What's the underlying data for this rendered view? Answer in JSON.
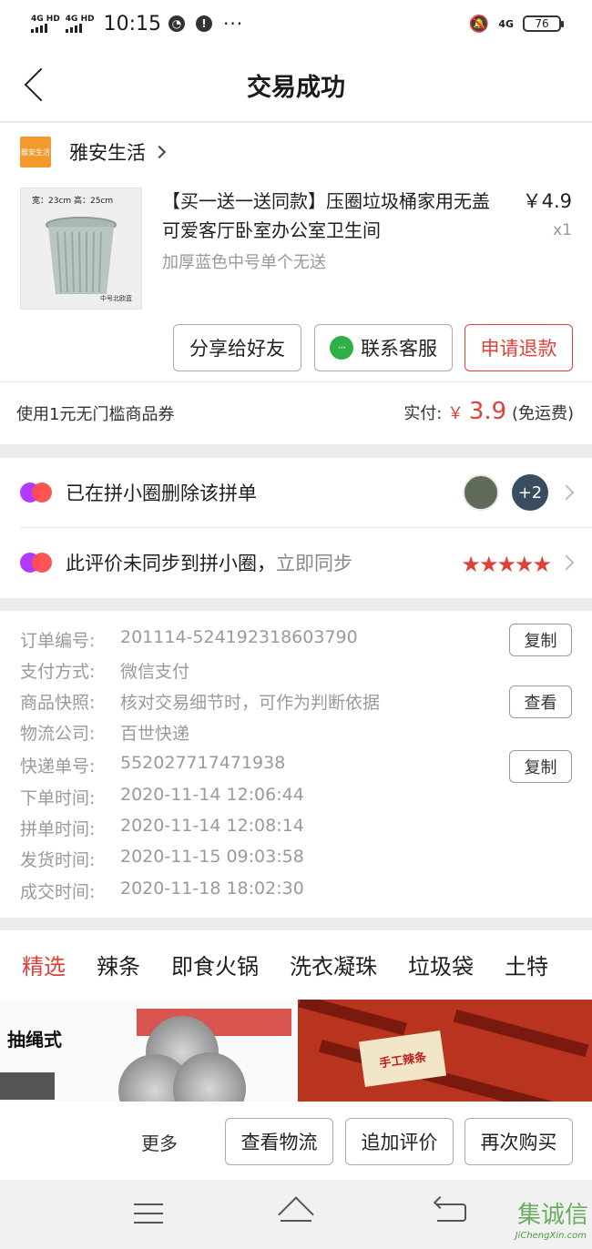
{
  "status_bar": {
    "network_1": "4G HD",
    "network_2": "4G HD",
    "time": "10:15",
    "network_right": "4G",
    "battery": "76"
  },
  "nav": {
    "title": "交易成功"
  },
  "store": {
    "name": "雅安生活",
    "logo_text": "雅安生活"
  },
  "product": {
    "image_dims": "宽：23cm  高：25cm",
    "image_caption": "中号北欧蓝",
    "title": "【买一送一送同款】压圈垃圾桶家用无盖可爱客厅卧室办公室卫生间",
    "price": "￥4.9",
    "qty": "x1",
    "spec": "加厚蓝色中号单个无送"
  },
  "product_actions": {
    "share": "分享给好友",
    "service": "联系客服",
    "refund": "申请退款"
  },
  "payment": {
    "coupon": "使用1元无门槛商品券",
    "paid_label": "实付:",
    "currency": "￥",
    "amount": "3.9",
    "shipping": "(免运费)"
  },
  "social": {
    "row1_text": "已在拼小圈删除该拼单",
    "avatar_more": "+2",
    "row2_text": "此评价未同步到拼小圈，",
    "row2_link": "立即同步",
    "stars": "★★★★★"
  },
  "order_info": {
    "rows": [
      {
        "label": "订单编号:",
        "value": "201114-524192318603790"
      },
      {
        "label": "支付方式:",
        "value": "微信支付"
      },
      {
        "label": "商品快照:",
        "value": "核对交易细节时，可作为判断依据"
      },
      {
        "label": "物流公司:",
        "value": "百世快递"
      },
      {
        "label": "快递单号:",
        "value": "552027717471938"
      },
      {
        "label": "下单时间:",
        "value": "2020-11-14 12:06:44"
      },
      {
        "label": "拼单时间:",
        "value": "2020-11-14 12:08:14"
      },
      {
        "label": "发货时间:",
        "value": "2020-11-15 09:03:58"
      },
      {
        "label": "成交时间:",
        "value": "2020-11-18 18:02:30"
      }
    ],
    "copy_label": "复制",
    "view_label": "查看"
  },
  "recommend": {
    "tabs": [
      "精选",
      "辣条",
      "即食火锅",
      "洗衣凝珠",
      "垃圾袋",
      "土特"
    ],
    "item1_tag": "抽绳式",
    "item2_tag": "手工辣条"
  },
  "bottom_actions": {
    "more": "更多",
    "logistics": "查看物流",
    "review": "追加评价",
    "rebuy": "再次购买"
  },
  "watermark": {
    "text": "集诚信",
    "sub": "JiChengXin.com"
  },
  "colors": {
    "accent": "#e0403a",
    "store_logo": "#f29a2e",
    "wechat": "#2db146"
  }
}
